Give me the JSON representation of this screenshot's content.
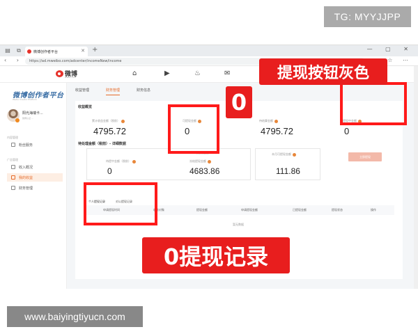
{
  "watermark_top": "TG: MYYJJPP",
  "watermark_bottom": "www.baiyingtiyucn.com",
  "browser": {
    "tab_title": "微博创作者平台",
    "url": "https://ad.mweibo.com/adcenter/incomeNew/income",
    "new_tab": "+",
    "win_controls": "— ▢ ✕",
    "nav_icons": "‹ › ↻",
    "addr_icons": "☆ ⋯"
  },
  "site": {
    "logo_word": "微博",
    "logo_sub": "weibo.com",
    "brand": "微博创作者平台",
    "brand_sub": "Weibo Creator Platform",
    "user_name": "阳光海瑞卡...",
    "user_sub": "微博认证 ...",
    "section_labels": [
      "内容管理",
      "广告管理"
    ],
    "menu_items": [
      {
        "label": "粉丝服务",
        "active": false
      },
      {
        "label": "收入概况",
        "active": false
      },
      {
        "label": "我的收益",
        "active": true
      },
      {
        "label": "财务管理",
        "active": false
      }
    ]
  },
  "subtabs": [
    {
      "label": "收益管理",
      "active": false
    },
    {
      "label": "财务管理",
      "active": true
    },
    {
      "label": "财务信息",
      "active": false
    }
  ],
  "overview": {
    "title": "收益概览",
    "stats": [
      {
        "label": "累计收益金额（税前）",
        "value": "4795.72"
      },
      {
        "label": "可提现金额",
        "value": "0"
      },
      {
        "label": "待结算金额",
        "value": "4795.72"
      },
      {
        "label": "提现中金额",
        "value": "0"
      }
    ],
    "withdraw_button": "立即提现"
  },
  "detail": {
    "title": "待处理金额（税前）- 详细数据",
    "items": [
      {
        "label": "待提中金额（税前）",
        "value": "0"
      },
      {
        "label": "冻结提现金额",
        "value": "4683.86"
      },
      {
        "label": "本月可提现金额",
        "value": "111.86"
      }
    ],
    "top_labels": [
      "可提现金额",
      "本月可提现金额"
    ]
  },
  "list": {
    "tabs": [
      {
        "label": "个人提现记录",
        "active": true
      },
      {
        "label": "对公提现记录",
        "active": false
      }
    ],
    "columns": [
      "申请提现时间",
      "收款对象",
      "提现金额",
      "申请提现金额",
      "已提现金额",
      "提现状态",
      "操作"
    ],
    "empty_text": "暂无数据"
  },
  "annotations": {
    "callout_button_gray": "提现按钮灰色",
    "callout_zero": "0",
    "callout_zero_records": "0提现记录"
  }
}
